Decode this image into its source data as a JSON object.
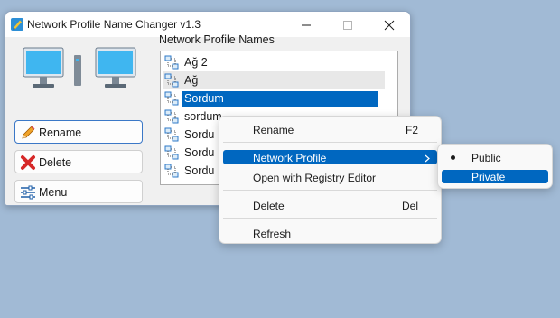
{
  "window": {
    "title": "Network Profile Name Changer v1.3"
  },
  "sidebar": {
    "buttons": [
      {
        "label": "Rename",
        "icon": "pencil-icon"
      },
      {
        "label": "Delete",
        "icon": "red-x-icon"
      },
      {
        "label": "Menu",
        "icon": "sliders-icon"
      }
    ]
  },
  "main": {
    "list_label": "Network Profile Names",
    "items": [
      "Ağ 2",
      "Ağ",
      "Sordum",
      "sordum",
      "Sordu",
      "Sordu",
      "Sordu"
    ],
    "selected_index": 2
  },
  "context_menu": {
    "items": [
      {
        "label": "Rename",
        "shortcut": "F2"
      },
      {
        "label": "Network Profile",
        "submenu": true
      },
      {
        "label": "Open with Registry Editor"
      },
      {
        "label": "Delete",
        "shortcut": "Del"
      },
      {
        "label": "Refresh"
      }
    ]
  },
  "submenu": {
    "items": [
      {
        "label": "Public",
        "checked": true
      },
      {
        "label": "Private",
        "highlighted": true
      }
    ]
  },
  "colors": {
    "desktop": "#a1bad5",
    "selection": "#0067c0",
    "menu_bg": "#f9f9f9"
  }
}
